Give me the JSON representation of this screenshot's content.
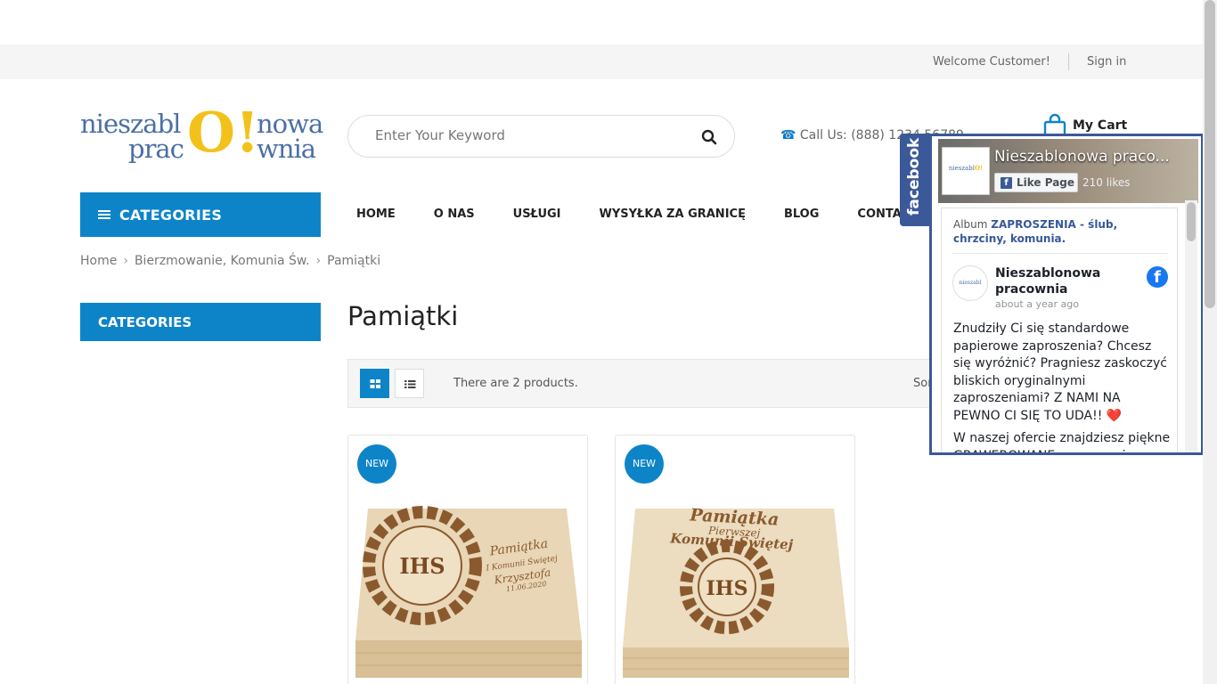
{
  "topbar": {
    "welcome": "Welcome Customer!",
    "signin": "Sign in"
  },
  "logo": {
    "part1": "nieszabl",
    "part2": "prac",
    "big": "O!",
    "part3": "nowa",
    "part4": "wnia"
  },
  "search": {
    "placeholder": "Enter Your Keyword"
  },
  "header": {
    "call": "Call Us: (888) 1234 56789",
    "cart": "My Cart"
  },
  "categories_button": "CATEGORIES",
  "nav": [
    "HOME",
    "O NAS",
    "USŁUGI",
    "WYSYŁKA ZA GRANICĘ",
    "BLOG",
    "CONTACT"
  ],
  "breadcrumb": [
    "Home",
    "Bierzmowanie, Komunia Św.",
    "Pamiątki"
  ],
  "sidebar": {
    "title": "CATEGORIES"
  },
  "page": {
    "title": "Pamiątki"
  },
  "toolbar": {
    "count": "There are 2 products.",
    "sort": "Sor"
  },
  "products": [
    {
      "badge": "NEW",
      "engraving": "IHS",
      "script1": "Pamiątka",
      "script2": "I Komunii Świętej",
      "script3": "Krzysztofa",
      "script4": "11.06.2020"
    },
    {
      "badge": "NEW",
      "engraving": "IHS",
      "script1": "Pamiątka",
      "script2": "Pierwszej",
      "script3": "Komunii Świętej"
    }
  ],
  "facebook": {
    "tab": "facebook",
    "page_name": "Nieszablonowa praco...",
    "like_button": "Like Page",
    "likes": "210 likes",
    "album_prefix": "Album ",
    "album_name": "ZAPROSZENIA - ślub, chrzciny, komunia.",
    "poster": "Nieszablonowa pracownia",
    "time": "about a year ago",
    "text1": "Znudziły Ci się standardowe papierowe zaproszenia? Chcesz się wyróżnić? Pragniesz zaskoczyć bliskich oryginalnymi zaproszeniami? Z NAMI NA PEWNO CI SIĘ TO UDA!! ❤️",
    "text2": "W naszej ofercie znajdziesz piękne GRAWEROWANE zaproszenia"
  }
}
